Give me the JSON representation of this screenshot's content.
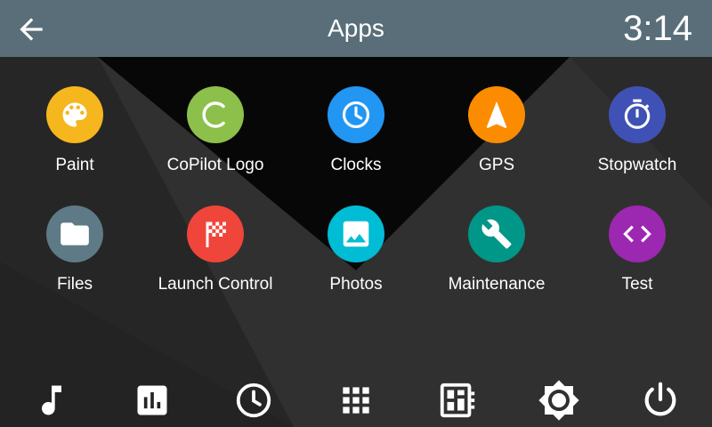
{
  "header": {
    "title": "Apps",
    "time": "3:14",
    "back_icon": "arrow-left-icon"
  },
  "apps": [
    {
      "label": "Paint",
      "icon": "palette-icon",
      "color": "#f6b61d"
    },
    {
      "label": "CoPilot Logo",
      "icon": "copilot-logo-icon",
      "color": "#8cc04a"
    },
    {
      "label": "Clocks",
      "icon": "clock-icon",
      "color": "#2196f3"
    },
    {
      "label": "GPS",
      "icon": "navigation-arrow-icon",
      "color": "#fb8c00"
    },
    {
      "label": "Stopwatch",
      "icon": "stopwatch-icon",
      "color": "#3f51b5"
    },
    {
      "label": "Files",
      "icon": "folder-icon",
      "color": "#5e7a86"
    },
    {
      "label": "Launch Control",
      "icon": "checkered-flag-icon",
      "color": "#f0453a"
    },
    {
      "label": "Photos",
      "icon": "image-icon",
      "color": "#00bcd4"
    },
    {
      "label": "Maintenance",
      "icon": "wrench-icon",
      "color": "#009688"
    },
    {
      "label": "Test",
      "icon": "code-icon",
      "color": "#9c27b0"
    }
  ],
  "dock": [
    {
      "icon": "music-note-icon"
    },
    {
      "icon": "bar-chart-icon"
    },
    {
      "icon": "clock-icon"
    },
    {
      "icon": "apps-grid-icon"
    },
    {
      "icon": "dashboard-icon"
    },
    {
      "icon": "settings-brightness-icon"
    },
    {
      "icon": "power-icon"
    }
  ],
  "colors": {
    "header_bg": "#596e78",
    "background": "#2b2b2b"
  }
}
